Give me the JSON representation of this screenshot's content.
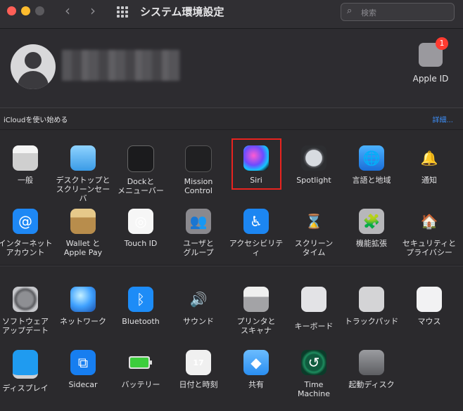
{
  "window": {
    "title": "システム環境設定",
    "search_placeholder": "検索"
  },
  "account": {
    "apple_id_label": "Apple ID",
    "badge_count": "1"
  },
  "icloud": {
    "prompt": "iCloudを使い始める",
    "details_link": "詳細..."
  },
  "section1": [
    {
      "label": "一般",
      "icon": "general-icon"
    },
    {
      "label": "デスクトップと\nスクリーンセーバ",
      "icon": "desktop-icon"
    },
    {
      "label": "Dockと\nメニューバー",
      "icon": "dock-icon"
    },
    {
      "label": "Mission\nControl",
      "icon": "mission-control-icon"
    },
    {
      "label": "Siri",
      "icon": "siri-icon"
    },
    {
      "label": "Spotlight",
      "icon": "spotlight-icon"
    },
    {
      "label": "言語と地域",
      "icon": "globe-flag-icon"
    },
    {
      "label": "通知",
      "icon": "bell-icon"
    },
    {
      "label": "インターネット\nアカウント",
      "icon": "at-icon"
    },
    {
      "label": "Wallet と\nApple Pay",
      "icon": "wallet-icon"
    },
    {
      "label": "Touch ID",
      "icon": "fingerprint-icon"
    },
    {
      "label": "ユーザと\nグループ",
      "icon": "users-icon"
    },
    {
      "label": "アクセシビリティ",
      "icon": "accessibility-icon"
    },
    {
      "label": "スクリーン\nタイム",
      "icon": "hourglass-icon"
    },
    {
      "label": "機能拡張",
      "icon": "puzzle-icon"
    },
    {
      "label": "セキュリティと\nプライバシー",
      "icon": "house-lock-icon"
    }
  ],
  "section2": [
    {
      "label": "ソフトウェア\nアップデート",
      "icon": "gear-update-icon"
    },
    {
      "label": "ネットワーク",
      "icon": "network-globe-icon"
    },
    {
      "label": "Bluetooth",
      "icon": "bluetooth-icon"
    },
    {
      "label": "サウンド",
      "icon": "speaker-icon"
    },
    {
      "label": "プリンタと\nスキャナ",
      "icon": "printer-icon"
    },
    {
      "label": "キーボード",
      "icon": "keyboard-icon"
    },
    {
      "label": "トラックパッド",
      "icon": "trackpad-icon"
    },
    {
      "label": "マウス",
      "icon": "mouse-icon"
    },
    {
      "label": "ディスプレイ",
      "icon": "display-icon"
    },
    {
      "label": "Sidecar",
      "icon": "sidecar-icon"
    },
    {
      "label": "バッテリー",
      "icon": "battery-icon"
    },
    {
      "label": "日付と時刻",
      "icon": "clock-calendar-icon"
    },
    {
      "label": "共有",
      "icon": "shared-folder-icon"
    },
    {
      "label": "Time\nMachine",
      "icon": "time-machine-icon"
    },
    {
      "label": "起動ディスク",
      "icon": "hard-disk-icon"
    }
  ],
  "calendar_day": "17"
}
